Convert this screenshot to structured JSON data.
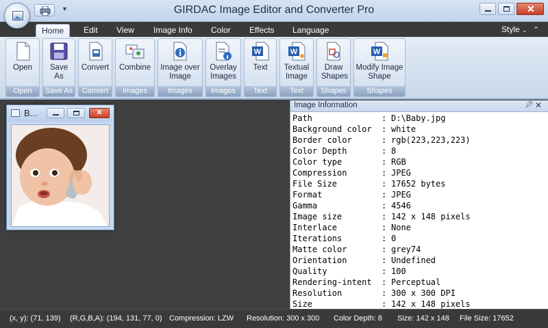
{
  "window": {
    "title": "GIRDAC Image Editor and Converter Pro"
  },
  "tabs": [
    {
      "label": "Home"
    },
    {
      "label": "Edit"
    },
    {
      "label": "View"
    },
    {
      "label": "Image Info"
    },
    {
      "label": "Color"
    },
    {
      "label": "Effects"
    },
    {
      "label": "Language"
    }
  ],
  "style_menu": {
    "label": "Style"
  },
  "ribbon": {
    "groups": [
      {
        "label": "Open",
        "buttons": [
          {
            "label": "Open",
            "icon": "open-file-icon"
          }
        ]
      },
      {
        "label": "Save As",
        "buttons": [
          {
            "label": "Save As",
            "icon": "save-disk-icon"
          }
        ]
      },
      {
        "label": "Convert",
        "buttons": [
          {
            "label": "Convert",
            "icon": "convert-icon"
          }
        ]
      },
      {
        "label": "Images",
        "buttons": [
          {
            "label": "Combine",
            "icon": "combine-images-icon"
          }
        ]
      },
      {
        "label": "Images",
        "buttons": [
          {
            "label": "Image over Image",
            "icon": "image-over-image-icon"
          }
        ]
      },
      {
        "label": "Images",
        "buttons": [
          {
            "label": "Overlay Images",
            "icon": "overlay-images-icon"
          }
        ]
      },
      {
        "label": "Text",
        "buttons": [
          {
            "label": "Text",
            "icon": "text-doc-icon"
          }
        ]
      },
      {
        "label": "Text",
        "buttons": [
          {
            "label": "Textual Image",
            "icon": "textual-image-icon"
          }
        ]
      },
      {
        "label": "Shapes",
        "buttons": [
          {
            "label": "Draw Shapes",
            "icon": "draw-shapes-icon"
          }
        ]
      },
      {
        "label": "Shapes",
        "buttons": [
          {
            "label": "Modify Image Shape",
            "icon": "modify-shape-icon"
          }
        ]
      }
    ]
  },
  "image_window": {
    "title": "B..."
  },
  "info_panel": {
    "title": "Image Information",
    "rows": [
      {
        "key": "Path",
        "value": "D:\\Baby.jpg"
      },
      {
        "key": "Background color",
        "value": "white"
      },
      {
        "key": "Border color",
        "value": "rgb(223,223,223)"
      },
      {
        "key": "Color Depth",
        "value": "8"
      },
      {
        "key": "Color type",
        "value": "RGB"
      },
      {
        "key": "Compression",
        "value": "JPEG"
      },
      {
        "key": "File Size",
        "value": "17652 bytes"
      },
      {
        "key": "Format",
        "value": "JPEG"
      },
      {
        "key": "Gamma",
        "value": "4546"
      },
      {
        "key": "Image size",
        "value": "142 x 148 pixels"
      },
      {
        "key": "Interlace",
        "value": "None"
      },
      {
        "key": "Iterations",
        "value": "0"
      },
      {
        "key": "Matte color",
        "value": "grey74"
      },
      {
        "key": "Orientation",
        "value": "Undefined"
      },
      {
        "key": "Quality",
        "value": "100"
      },
      {
        "key": "Rendering-intent",
        "value": "Perceptual"
      },
      {
        "key": "Resolution",
        "value": "300 x 300 DPI"
      },
      {
        "key": "Size",
        "value": "142 x 148 pixels"
      }
    ]
  },
  "status": {
    "xy": "(x, y): (71, 139)",
    "rgba": "(R,G,B,A): (194, 131, 77, 0)",
    "compression": "Compression: LZW",
    "resolution": "Resolution: 300 x 300",
    "color_depth": "Color Depth: 8",
    "size": "Size: 142 x 148",
    "file_size": "File Size: 17652"
  }
}
